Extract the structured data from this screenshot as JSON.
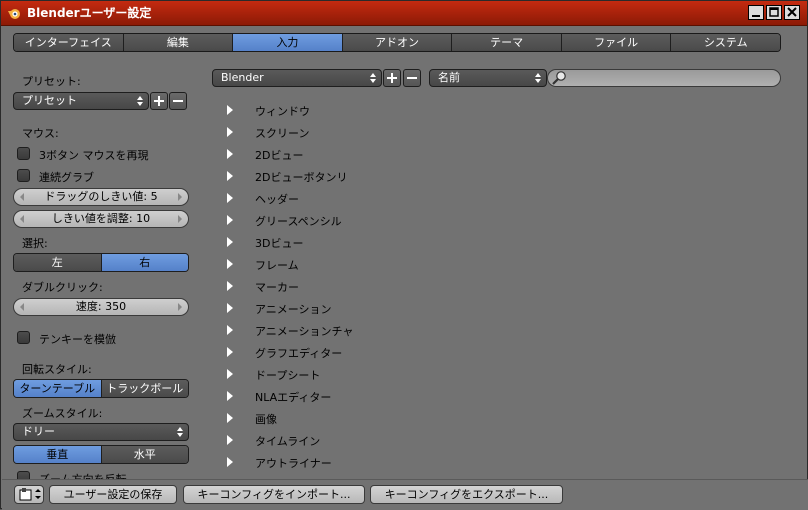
{
  "window": {
    "title": "Blenderユーザー設定"
  },
  "tabs": [
    {
      "label": "インターフェイス",
      "active": false
    },
    {
      "label": "編集",
      "active": false
    },
    {
      "label": "入力",
      "active": true
    },
    {
      "label": "アドオン",
      "active": false
    },
    {
      "label": "テーマ",
      "active": false
    },
    {
      "label": "ファイル",
      "active": false
    },
    {
      "label": "システム",
      "active": false
    }
  ],
  "left": {
    "preset_label": "プリセット:",
    "preset_value": "プリセット",
    "mouse_label": "マウス:",
    "emulate_3button": "3ボタン マウスを再現",
    "continuous_grab": "連続グラブ",
    "drag_threshold": "ドラッグのしきい値: 5",
    "tweak_threshold": "しきい値を調整: 10",
    "select_label": "選択:",
    "select_left": "左",
    "select_right": "右",
    "double_click_label": "ダブルクリック:",
    "speed": "速度: 350",
    "emulate_numpad": "テンキーを模倣",
    "rotation_label": "回転スタイル:",
    "turntable": "ターンテーブル",
    "trackball": "トラックボール",
    "zoom_label": "ズームスタイル:",
    "zoom_style": "ドリー",
    "vertical": "垂直",
    "horizontal": "水平",
    "invert_zoom": "ズーム方向を反転"
  },
  "keymap": {
    "preset_value": "Blender",
    "search_mode": "名前",
    "search_placeholder": "",
    "items": [
      "ウィンドウ",
      "スクリーン",
      "2Dビュー",
      "2Dビューボタンリ",
      "ヘッダー",
      "グリースペンシル",
      "3Dビュー",
      "フレーム",
      "マーカー",
      "アニメーション",
      "アニメーションチャ",
      "グラフエディター",
      "ドープシート",
      "NLAエディター",
      "画像",
      "タイムライン",
      "アウトライナー"
    ]
  },
  "footer": {
    "save": "ユーザー設定の保存",
    "import": "キーコンフィグをインポート...",
    "export": "キーコンフィグをエクスポート..."
  }
}
